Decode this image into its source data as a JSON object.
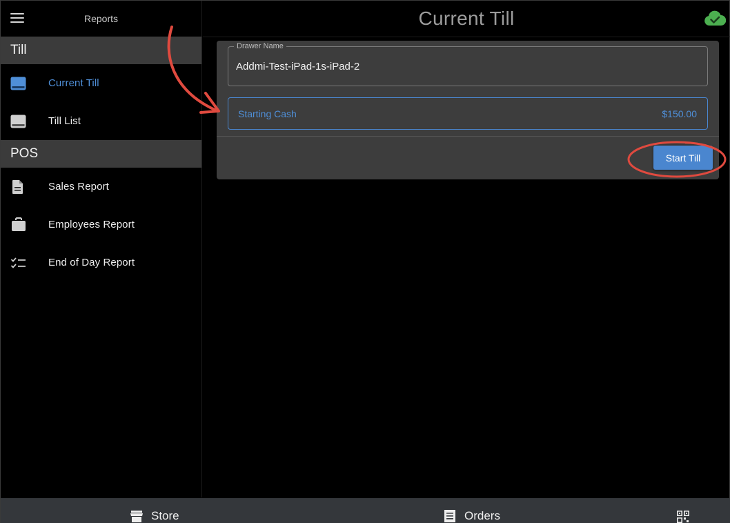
{
  "sidebar": {
    "title": "Reports",
    "sections": [
      {
        "label": "Till",
        "items": [
          {
            "label": "Current Till",
            "icon": "till-icon",
            "active": true
          },
          {
            "label": "Till List",
            "icon": "till-icon",
            "active": false
          }
        ]
      },
      {
        "label": "POS",
        "items": [
          {
            "label": "Sales Report",
            "icon": "document-icon",
            "active": false
          },
          {
            "label": "Employees Report",
            "icon": "briefcase-icon",
            "active": false
          },
          {
            "label": "End of Day Report",
            "icon": "checklist-icon",
            "active": false
          }
        ]
      }
    ]
  },
  "header": {
    "title": "Current Till",
    "sync_icon": "cloud-check-icon"
  },
  "till_form": {
    "drawer_name_label": "Drawer Name",
    "drawer_name_value": "Addmi-Test-iPad-1s-iPad-2",
    "starting_cash_label": "Starting Cash",
    "starting_cash_value": "$150.00",
    "start_button_label": "Start Till"
  },
  "bottom_nav": {
    "items": [
      {
        "label": "Store",
        "icon": "store-icon"
      },
      {
        "label": "Orders",
        "icon": "orders-icon"
      },
      {
        "label": "",
        "icon": "qr-code-icon"
      }
    ]
  },
  "colors": {
    "accent": "#4a86cf",
    "annotation": "#e04a3f",
    "sync_green": "#4caf50",
    "section_bg": "#3b3b3b",
    "card_bg": "#3d3d3d",
    "bottom_bar_bg": "#34373b"
  }
}
